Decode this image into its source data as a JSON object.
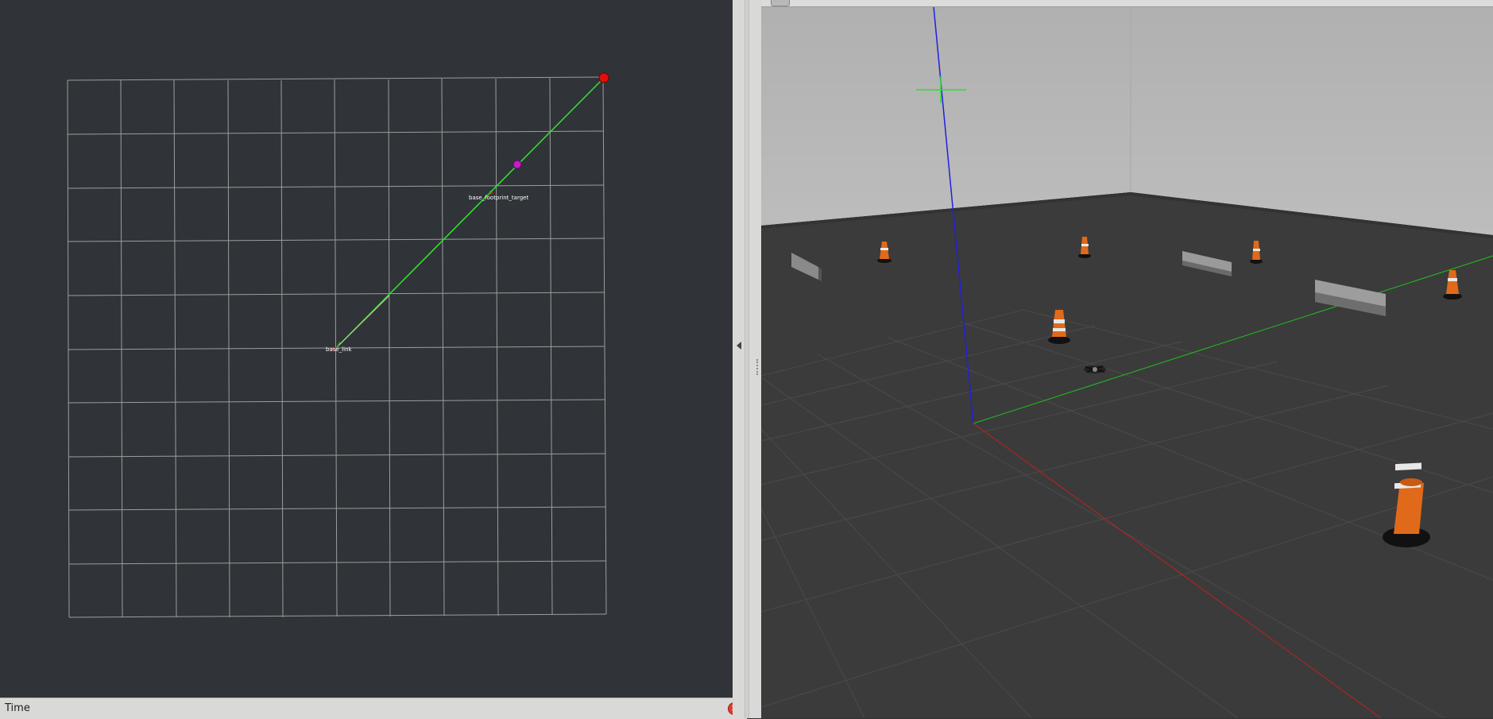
{
  "left_view": {
    "tf_target_label": "base_footprint_target",
    "tf_origin_label": "base_link"
  },
  "bottom_panel": {
    "title": "Time",
    "close_glyph": "×"
  },
  "colors": {
    "background": "#303438",
    "grid": "#a6a9ab",
    "path": "#2ee62e",
    "goal_marker": "#e01010",
    "waypoint_marker": "#c020c0",
    "gazebo_sky": "#b2b2b2",
    "gazebo_floor": "#3c3c3c",
    "axis_x": "#c02020",
    "axis_y": "#20c020",
    "axis_z": "#2020e0",
    "cone_orange": "#e06a1a"
  },
  "icons": {
    "splitter": "triangle-left-icon",
    "close": "close-icon"
  }
}
